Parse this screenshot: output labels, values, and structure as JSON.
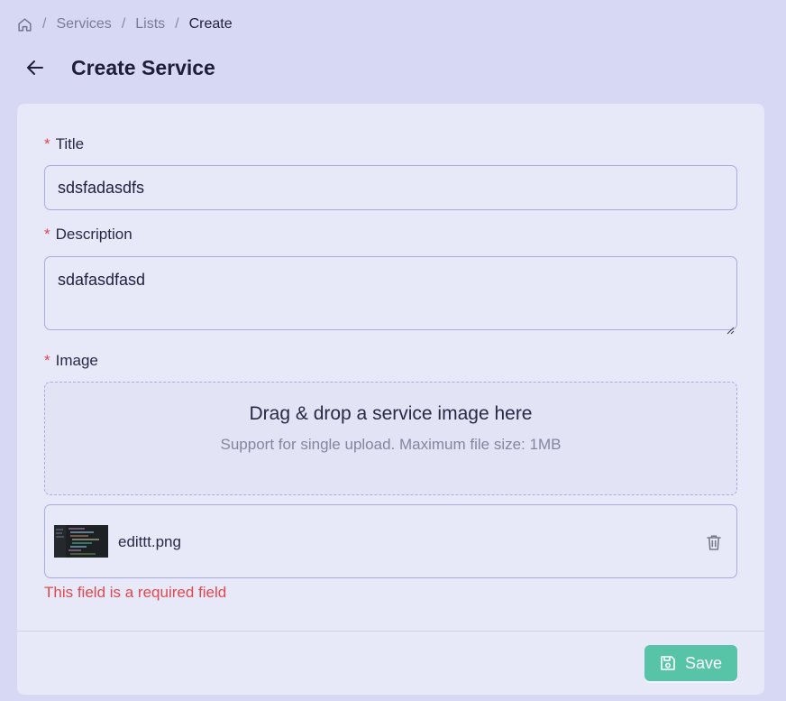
{
  "breadcrumb": {
    "home_icon": "home-icon",
    "separator": "/",
    "items": [
      "Services",
      "Lists",
      "Create"
    ]
  },
  "header": {
    "back_icon": "arrow-left-icon",
    "title": "Create Service"
  },
  "form": {
    "required_marker": "*",
    "title": {
      "label": "Title",
      "value": "sdsfadasdfs"
    },
    "description": {
      "label": "Description",
      "value": "sdafasdfasd"
    },
    "image": {
      "label": "Image",
      "dropzone_title": "Drag & drop a service image here",
      "dropzone_subtitle": "Support for single upload. Maximum file size: 1MB",
      "file": {
        "name": "edittt.png",
        "delete_icon": "trash-icon"
      },
      "error": "This field is a required field"
    }
  },
  "actions": {
    "save_label": "Save",
    "save_icon": "save-icon"
  },
  "colors": {
    "background": "#d6d8f4",
    "card": "#e7e8f8",
    "border": "#a9abe2",
    "required": "#e0484f",
    "primary": "#58c4a7"
  }
}
